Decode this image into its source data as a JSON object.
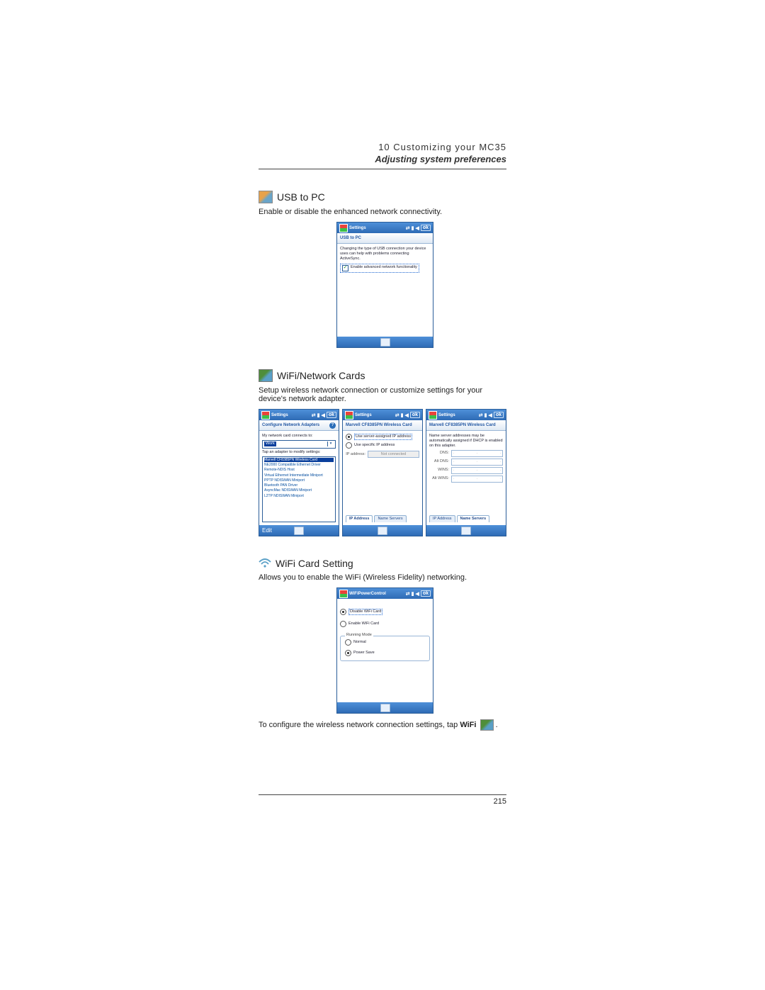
{
  "header": {
    "chapter": "10 Customizing your MC35",
    "section": "Adjusting system preferences"
  },
  "page_number": "215",
  "section_usb": {
    "title": "USB to PC",
    "desc": "Enable or disable the enhanced network connectivity.",
    "shot": {
      "title": "Settings",
      "ok": "ok",
      "subbar": "USB to PC",
      "body": "Changing the type of USB connection your device uses can help with problems connecting ActiveSync.",
      "checkbox_label": "Enable advanced network functionality",
      "checkbox_checked": true
    }
  },
  "section_netcards": {
    "title": "WiFi/Network Cards",
    "desc": "Setup wireless network connection or customize settings for your device's network adapter.",
    "shot1": {
      "title": "Settings",
      "ok": "ok",
      "subbar": "Configure Network Adapters",
      "connects_label": "My network card connects to:",
      "dropdown_value": "Work",
      "tap_label": "Tap an adapter to modify settings:",
      "adapters": [
        "Marvell CF8385PN Wireless Card",
        "NE2000 Compatible Ethernet Driver",
        "Remote-NDIS Host",
        "Virtual Ethernet Intermediate Miniport",
        "PPTP NDISWAN Miniport",
        "Bluetooth PAN Driver",
        "AsyncMac NDISWAN Miniport",
        "L2TP NDISWAN Miniport"
      ],
      "selected_index": 0,
      "bottom_btn": "Edit"
    },
    "shot2": {
      "title": "Settings",
      "subbar": "Marvell CF8385PN Wireless Card",
      "radio1": "Use server-assigned IP address",
      "radio2": "Use specific IP address",
      "ip_label": "IP address:",
      "ip_status": "Not connected",
      "tab1": "IP Address",
      "tab2": "Name Servers"
    },
    "shot3": {
      "title": "Settings",
      "subbar": "Marvell CF8385PN Wireless Card",
      "note": "Name server addresses may be automatically assigned if DHCP is enabled on this adapter.",
      "fields": [
        "DNS:",
        "Alt DNS:",
        "WINS:",
        "Alt WINS:"
      ],
      "tab1": "IP Address",
      "tab2": "Name Servers"
    }
  },
  "section_wifi": {
    "title": "WiFi Card Setting",
    "desc": "Allows you to enable the WiFi (Wireless Fidelity) networking.",
    "shot": {
      "title": "WiFiPowerControl",
      "ok": "ok",
      "disable_label": "Disable WiFi Card",
      "enable_label": "Enable WiFi Card",
      "running_mode": "Running Mode",
      "normal": "Normal",
      "power_save": "Power Save"
    },
    "footnote_pre": "To configure the wireless network connection settings, tap ",
    "footnote_bold": "WiFi",
    "footnote_post": " ."
  }
}
